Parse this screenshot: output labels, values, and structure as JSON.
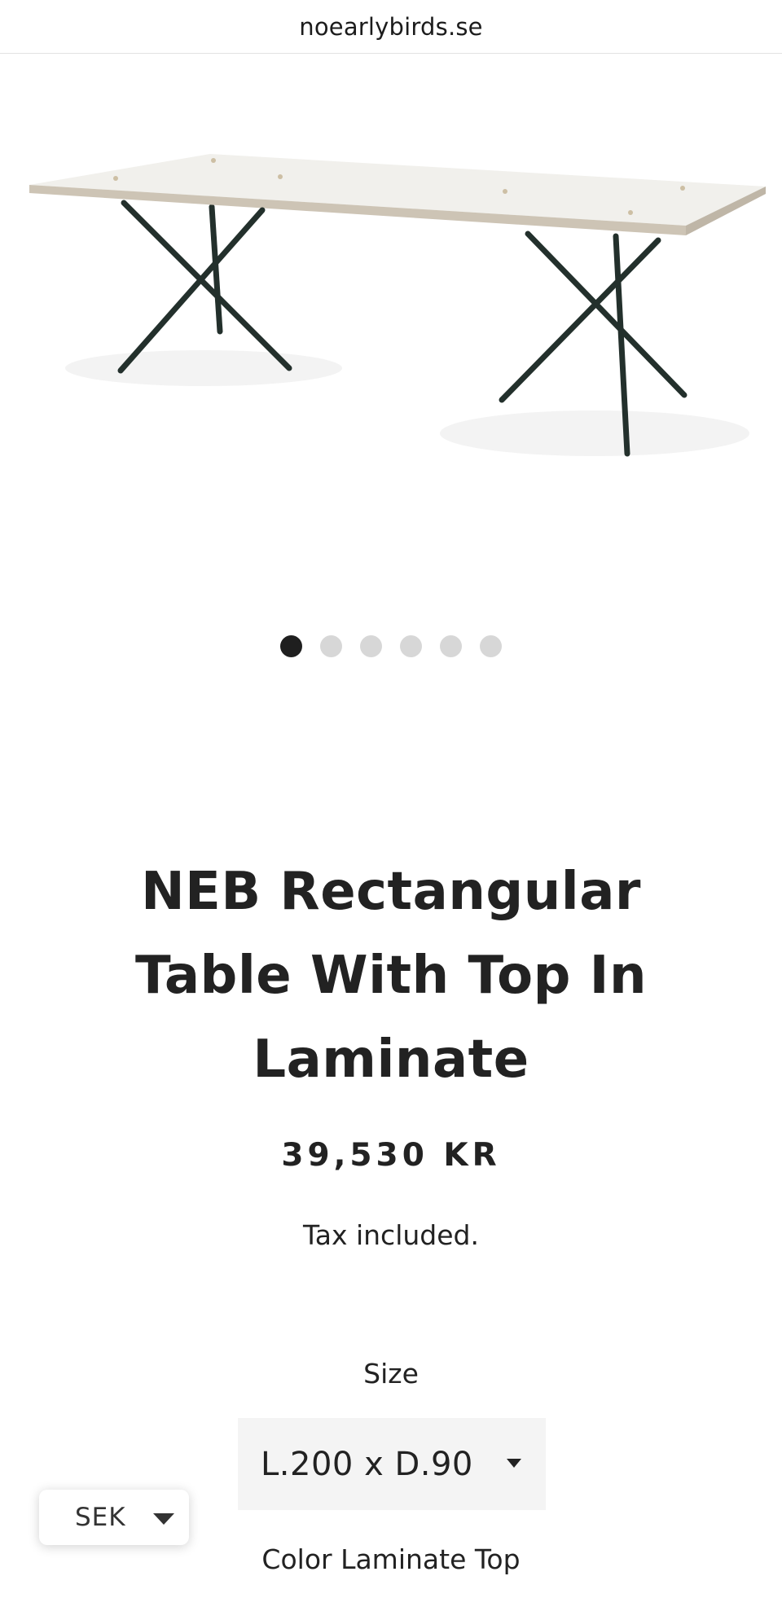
{
  "browser": {
    "url": "noearlybirds.se"
  },
  "product": {
    "image_icon": "table-photo",
    "gallery": {
      "slides": 6,
      "active_index": 0
    },
    "title": "NEB Rectangular Table With Top In Laminate",
    "price": "39,530 KR",
    "tax_note": "Tax included.",
    "options": {
      "size_label": "Size",
      "size_value": "L.200 x D.90",
      "color_label": "Color Laminate Top"
    }
  },
  "currency_selector": {
    "value": "SEK"
  },
  "colors": {
    "text": "#222222",
    "dot_active": "#1f1f1f",
    "dot_inactive": "#d7d7d7",
    "select_bg": "#f4f4f4",
    "table_legs": "#23302c"
  }
}
